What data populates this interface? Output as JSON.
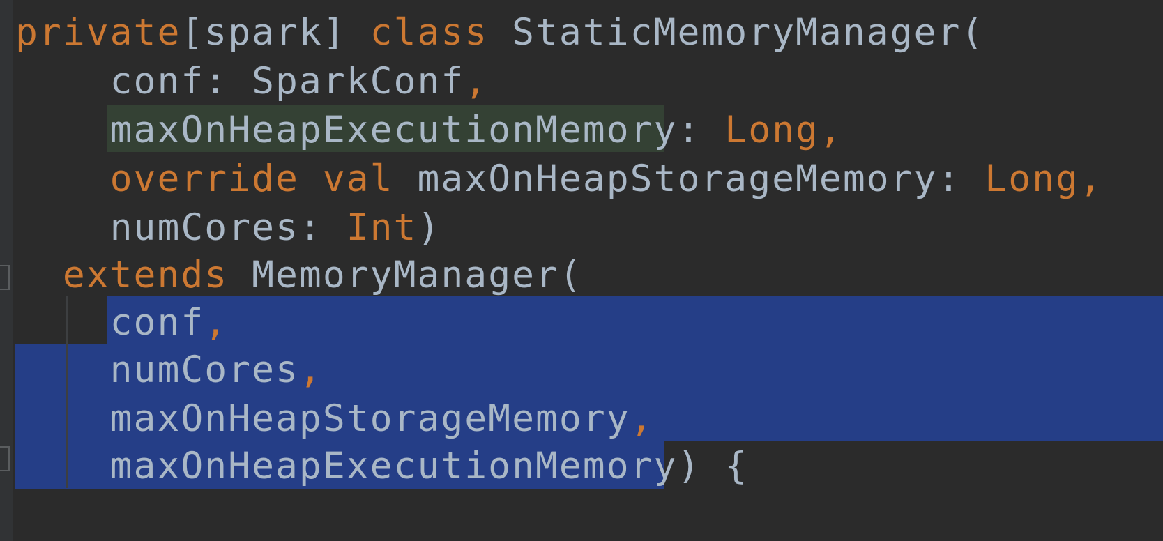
{
  "editor": {
    "theme_colors": {
      "background": "#2b2b2b",
      "keyword": "#cc7832",
      "text": "#a9b7c6",
      "selection": "#214283",
      "identifier_highlight": "#344134"
    },
    "lines": [
      {
        "tokens": [
          {
            "t": "private",
            "k": "keyword"
          },
          {
            "t": "[spark] ",
            "k": "text"
          },
          {
            "t": "class",
            "k": "keyword"
          },
          {
            "t": " StaticMemoryManager(",
            "k": "text"
          }
        ]
      },
      {
        "tokens": [
          {
            "t": "    conf: SparkConf",
            "k": "text"
          },
          {
            "t": ",",
            "k": "keyword"
          }
        ]
      },
      {
        "tokens": [
          {
            "t": "    maxOnHeapExecutionMemory",
            "k": "text"
          },
          {
            "t": ": ",
            "k": "text"
          },
          {
            "t": "Long",
            "k": "keyword"
          },
          {
            "t": ",",
            "k": "keyword"
          }
        ]
      },
      {
        "tokens": [
          {
            "t": "    ",
            "k": "text"
          },
          {
            "t": "override",
            "k": "keyword"
          },
          {
            "t": " ",
            "k": "text"
          },
          {
            "t": "val",
            "k": "keyword"
          },
          {
            "t": " maxOnHeapStorageMemory: ",
            "k": "text"
          },
          {
            "t": "Long",
            "k": "keyword"
          },
          {
            "t": ",",
            "k": "keyword"
          }
        ]
      },
      {
        "tokens": [
          {
            "t": "    numCores: ",
            "k": "text"
          },
          {
            "t": "Int",
            "k": "keyword"
          },
          {
            "t": ")",
            "k": "text"
          }
        ]
      },
      {
        "tokens": [
          {
            "t": "  ",
            "k": "text"
          },
          {
            "t": "extends",
            "k": "keyword"
          },
          {
            "t": " MemoryManager(",
            "k": "text"
          }
        ]
      },
      {
        "tokens": [
          {
            "t": "    conf",
            "k": "text"
          },
          {
            "t": ",",
            "k": "keyword"
          }
        ]
      },
      {
        "tokens": [
          {
            "t": "    numCores",
            "k": "text"
          },
          {
            "t": ",",
            "k": "keyword"
          }
        ]
      },
      {
        "tokens": [
          {
            "t": "    maxOnHeapStorageMemory",
            "k": "text"
          },
          {
            "t": ",",
            "k": "keyword"
          }
        ]
      },
      {
        "tokens": [
          {
            "t": "    maxOnHeapExecutionMemory",
            "k": "text"
          },
          {
            "t": ") {",
            "k": "text"
          }
        ]
      }
    ]
  }
}
